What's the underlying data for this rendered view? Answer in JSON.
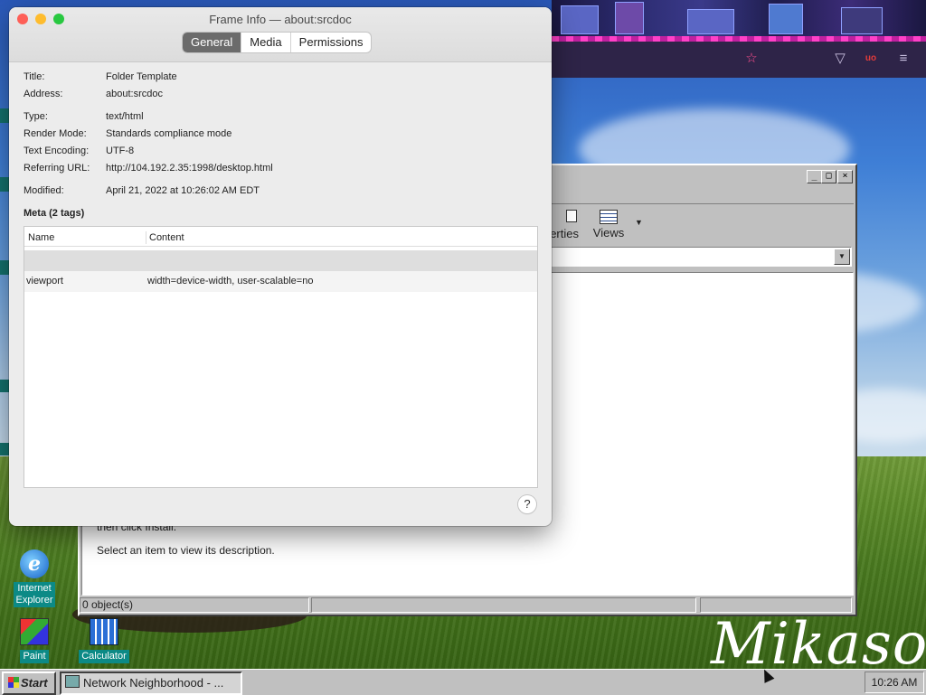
{
  "frame_info": {
    "window_title": "Frame Info — about:srcdoc",
    "tabs": [
      {
        "label": "General",
        "active": true
      },
      {
        "label": "Media",
        "active": false
      },
      {
        "label": "Permissions",
        "active": false
      }
    ],
    "fields": {
      "title": {
        "label": "Title:",
        "value": "Folder Template"
      },
      "address": {
        "label": "Address:",
        "value": "about:srcdoc"
      },
      "type": {
        "label": "Type:",
        "value": "text/html"
      },
      "render_mode": {
        "label": "Render Mode:",
        "value": "Standards compliance mode"
      },
      "encoding": {
        "label": "Text Encoding:",
        "value": "UTF-8"
      },
      "referrer": {
        "label": "Referring URL:",
        "value": "http://104.192.2.35:1998/desktop.html"
      },
      "modified": {
        "label": "Modified:",
        "value": "April 21, 2022 at 10:26:02 AM EDT"
      }
    },
    "meta_heading": "Meta (2 tags)",
    "meta_columns": [
      "Name",
      "Content"
    ],
    "meta_rows": [
      {
        "name": "",
        "content": ""
      },
      {
        "name": "viewport",
        "content": "width=device-width, user-scalable=no"
      }
    ],
    "help_label": "?"
  },
  "explorer": {
    "toolbar_properties_partial": "erties",
    "toolbar_views": "Views",
    "description_partial": "then click Install.",
    "description": "Select an item to view its description.",
    "status_objects": "0 object(s)"
  },
  "desktop_icons": [
    {
      "label_line1": "Internet",
      "label_line2": "Explorer"
    },
    {
      "label_line1": "Paint"
    },
    {
      "label_line1": "Calculator"
    }
  ],
  "taskbar": {
    "start_label": "Start",
    "task_label": "Network Neighborhood - ...",
    "clock": "10:26 AM"
  },
  "wallpaper_signature": "Mikaso",
  "colors": {
    "active_tab": "#6b6b6b",
    "desktop_label_bg": "#0c8a86",
    "win_face": "#c0c0c0"
  }
}
